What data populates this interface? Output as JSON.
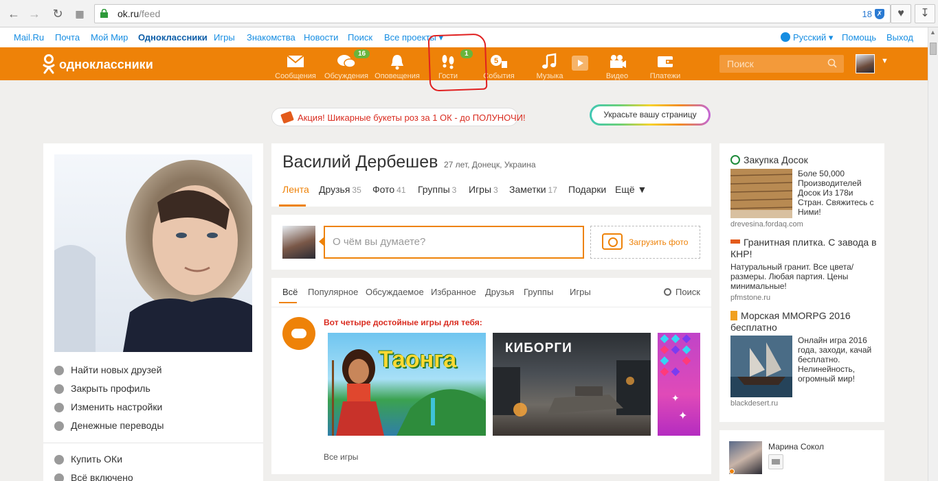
{
  "browser": {
    "url_domain": "ok.ru",
    "url_path": "/feed",
    "extension_count": "18",
    "extension_icon": "shield-icon"
  },
  "portal": {
    "links": [
      "Mail.Ru",
      "Почта",
      "Мой Мир",
      "Одноклассники",
      "Игры",
      "Знакомства",
      "Новости",
      "Поиск",
      "Все проекты ▾"
    ],
    "language": "Русский ▾",
    "help": "Помощь",
    "logout": "Выход"
  },
  "header": {
    "logo_text": "одноклассники",
    "nav": [
      {
        "label": "Сообщения",
        "icon": "envelope-icon",
        "badge": ""
      },
      {
        "label": "Обсуждения",
        "icon": "chat-bubbles-icon",
        "badge": "16"
      },
      {
        "label": "Оповещения",
        "icon": "bell-icon",
        "badge": ""
      },
      {
        "label": "Гости",
        "icon": "footprints-icon",
        "badge": "1"
      },
      {
        "label": "События",
        "icon": "events-icon",
        "badge": ""
      },
      {
        "label": "Музыка",
        "icon": "music-note-icon",
        "badge": ""
      },
      {
        "label": "Видео",
        "icon": "video-camera-icon",
        "badge": ""
      },
      {
        "label": "Платежи",
        "icon": "wallet-icon",
        "badge": ""
      }
    ],
    "search_placeholder": "Поиск",
    "accent_color": "#ee8208"
  },
  "promo": {
    "text": "Акция! Шикарные букеты роз за 1 ОК - до ПОЛУНОЧИ!",
    "decorate_label": "Украсьте вашу страницу"
  },
  "left_menu": {
    "items": [
      {
        "label": "Найти новых друзей",
        "icon": "person-icon"
      },
      {
        "label": "Закрыть профиль",
        "icon": "lock-icon"
      },
      {
        "label": "Изменить настройки",
        "icon": "gear-icon"
      },
      {
        "label": "Денежные переводы",
        "icon": "ruble-icon"
      }
    ],
    "items2": [
      {
        "label": "Купить ОКи",
        "icon": "coin-icon"
      },
      {
        "label": "Всё включено",
        "icon": "star-icon"
      }
    ]
  },
  "profile": {
    "name": "Василий Дербешев",
    "meta": "27 лет, Донецк, Украина",
    "tabs": [
      {
        "label": "Лента",
        "count": ""
      },
      {
        "label": "Друзья",
        "count": "35"
      },
      {
        "label": "Фото",
        "count": "41"
      },
      {
        "label": "Группы",
        "count": "3"
      },
      {
        "label": "Игры",
        "count": "3"
      },
      {
        "label": "Заметки",
        "count": "17"
      },
      {
        "label": "Подарки",
        "count": ""
      },
      {
        "label": "Ещё ▼",
        "count": ""
      }
    ]
  },
  "postbox": {
    "placeholder": "О чём вы думаете?",
    "upload_label": "Загрузить фото"
  },
  "feed": {
    "tabs": [
      "Всё",
      "Популярное",
      "Обсуждаемое",
      "Избранное",
      "Друзья",
      "Группы",
      "Игры"
    ],
    "search_label": "Поиск",
    "games_title": "Вот четыре достойные игры для тебя:",
    "game1_title": "Таонга",
    "game2_title": "КИБОРГИ",
    "all_games": "Все игры"
  },
  "ads": [
    {
      "title": "Закупка Досок",
      "icon": "ad-globe-icon",
      "desc": "Боле 50,000 Производителей Досок Из 178и Стран. Свяжитесь с Ними!",
      "source": "drevesina.fordaq.com"
    },
    {
      "title": "Гранитная плитка. С завода в КНР!",
      "icon": "ad-logo-icon",
      "desc": "Натуральный гранит. Все цвета/размеры. Любая партия. Цены минимальные!",
      "source": "pfmstone.ru"
    },
    {
      "title": "Морская MMORPG 2016 бесплатно",
      "icon": "ad-b-icon",
      "desc": "Онлайн игра 2016 года, заходи, качай бесплатно. Нелинейность, огромный мир!",
      "source": "blackdesert.ru"
    }
  ],
  "friend": {
    "name": "Марина Сокол"
  }
}
